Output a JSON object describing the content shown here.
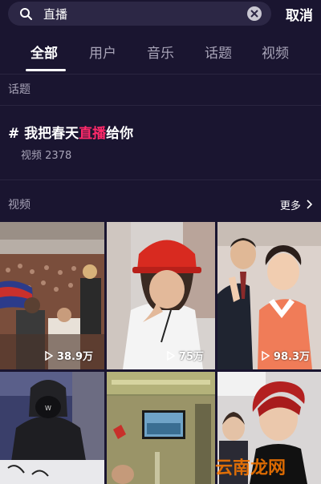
{
  "search": {
    "query": "直播",
    "cancel_label": "取消"
  },
  "tabs": [
    {
      "label": "全部",
      "active": true
    },
    {
      "label": "用户",
      "active": false
    },
    {
      "label": "音乐",
      "active": false
    },
    {
      "label": "话题",
      "active": false
    },
    {
      "label": "视频",
      "active": false
    }
  ],
  "topics": {
    "section_label": "话题",
    "item": {
      "hash": "#",
      "title_before": "我把春天",
      "title_highlight": "直播",
      "title_after": "给你",
      "meta": "视频 2378"
    }
  },
  "videos": {
    "section_label": "视频",
    "more_label": "更多",
    "items": [
      {
        "views": "38.9万"
      },
      {
        "views": "75万"
      },
      {
        "views": "98.3万"
      },
      {
        "views": ""
      },
      {
        "views": ""
      },
      {
        "views": ""
      }
    ]
  },
  "watermark": "云南龙网",
  "colors": {
    "background": "#1a1530",
    "accent_highlight": "#ff2a6a",
    "secondary_text": "#a8a4b8"
  }
}
